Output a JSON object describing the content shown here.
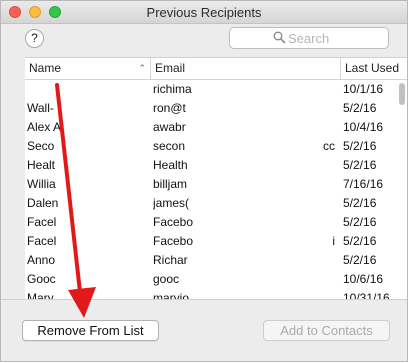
{
  "window": {
    "title": "Previous Recipients"
  },
  "toolbar": {
    "help_label": "?",
    "search_placeholder": "Search",
    "search_value": ""
  },
  "table": {
    "columns": [
      {
        "label": "Name",
        "sorted": "ascending"
      },
      {
        "label": "Email"
      },
      {
        "label": "Last Used"
      }
    ],
    "rows": [
      {
        "name": "",
        "email": "richima",
        "email_tail": "",
        "date": "10/1/16"
      },
      {
        "name": "Wall-",
        "email": "ron@t",
        "email_tail": "",
        "date": "5/2/16"
      },
      {
        "name": "Alex A",
        "email": "awabr",
        "email_tail": "",
        "date": "10/4/16"
      },
      {
        "name": "Seco",
        "email": "secon",
        "email_tail": "cc",
        "date": "5/2/16"
      },
      {
        "name": "Healt",
        "email": "Health",
        "email_tail": "",
        "date": "5/2/16"
      },
      {
        "name": "Willia",
        "email": "billjam",
        "email_tail": "",
        "date": "7/16/16"
      },
      {
        "name": "Dalen",
        "email": "james(",
        "email_tail": "",
        "date": "5/2/16"
      },
      {
        "name": "Facel",
        "email": "Facebo",
        "email_tail": "",
        "date": "5/2/16"
      },
      {
        "name": "Facel",
        "email": "Facebo",
        "email_tail": "i",
        "date": "5/2/16"
      },
      {
        "name": "Anno",
        "email": "Richar",
        "email_tail": "",
        "date": "5/2/16"
      },
      {
        "name": "Gooc",
        "email": "gooc",
        "email_tail": "",
        "date": "10/6/16"
      },
      {
        "name": "Mary",
        "email": "maryjo",
        "email_tail": "",
        "date": "10/31/16"
      }
    ]
  },
  "buttons": {
    "remove_label": "Remove From List",
    "add_label": "Add to Contacts"
  },
  "colors": {
    "arrow": "#e01a1a",
    "close": "#fc605b",
    "minimize": "#fdbc40",
    "maximize": "#34c84a"
  }
}
